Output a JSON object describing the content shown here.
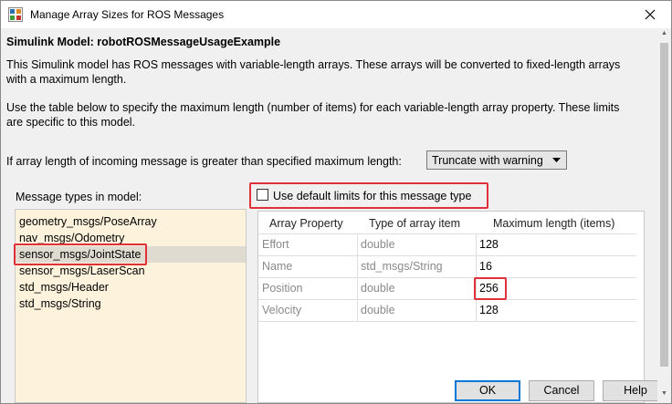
{
  "window": {
    "title": "Manage Array Sizes for ROS Messages",
    "app_icon": "simulink-icon",
    "close_icon": "close-icon"
  },
  "model_heading": "Simulink Model: robotROSMessageUsageExample",
  "para1_line1": "This Simulink model has ROS messages with variable-length arrays. These arrays will be converted to fixed-length arrays",
  "para1_line2": "with a maximum length.",
  "para2_line1": "Use the table below to specify the maximum length (number of items) for each variable-length array property. These limits",
  "para2_line2": "are specific to this model.",
  "truncation": {
    "label": "If array length of incoming message is greater than specified maximum length:",
    "selected": "Truncate with warning",
    "icon": "dropdown-arrow-icon"
  },
  "types_label": "Message types in model:",
  "message_types": [
    "geometry_msgs/PoseArray",
    "nav_msgs/Odometry",
    "sensor_msgs/JointState",
    "sensor_msgs/LaserScan",
    "std_msgs/Header",
    "std_msgs/String"
  ],
  "selected_type": "sensor_msgs/JointState",
  "default_limits": {
    "label": "Use default limits for this message type",
    "checked": false
  },
  "table": {
    "headers": [
      "Array Property",
      "Type of array item",
      "Maximum length (items)"
    ],
    "rows": [
      [
        "Effort",
        "double",
        "128"
      ],
      [
        "Name",
        "std_msgs/String",
        "16"
      ],
      [
        "Position",
        "double",
        "256"
      ],
      [
        "Velocity",
        "double",
        "128"
      ]
    ]
  },
  "buttons": {
    "ok": "OK",
    "cancel": "Cancel",
    "help": "Help"
  },
  "colors": {
    "highlight": "#e0303a",
    "list_background": "#fdf3dc",
    "selected_row": "#e0dbd0",
    "ok_border": "#0078d7"
  }
}
